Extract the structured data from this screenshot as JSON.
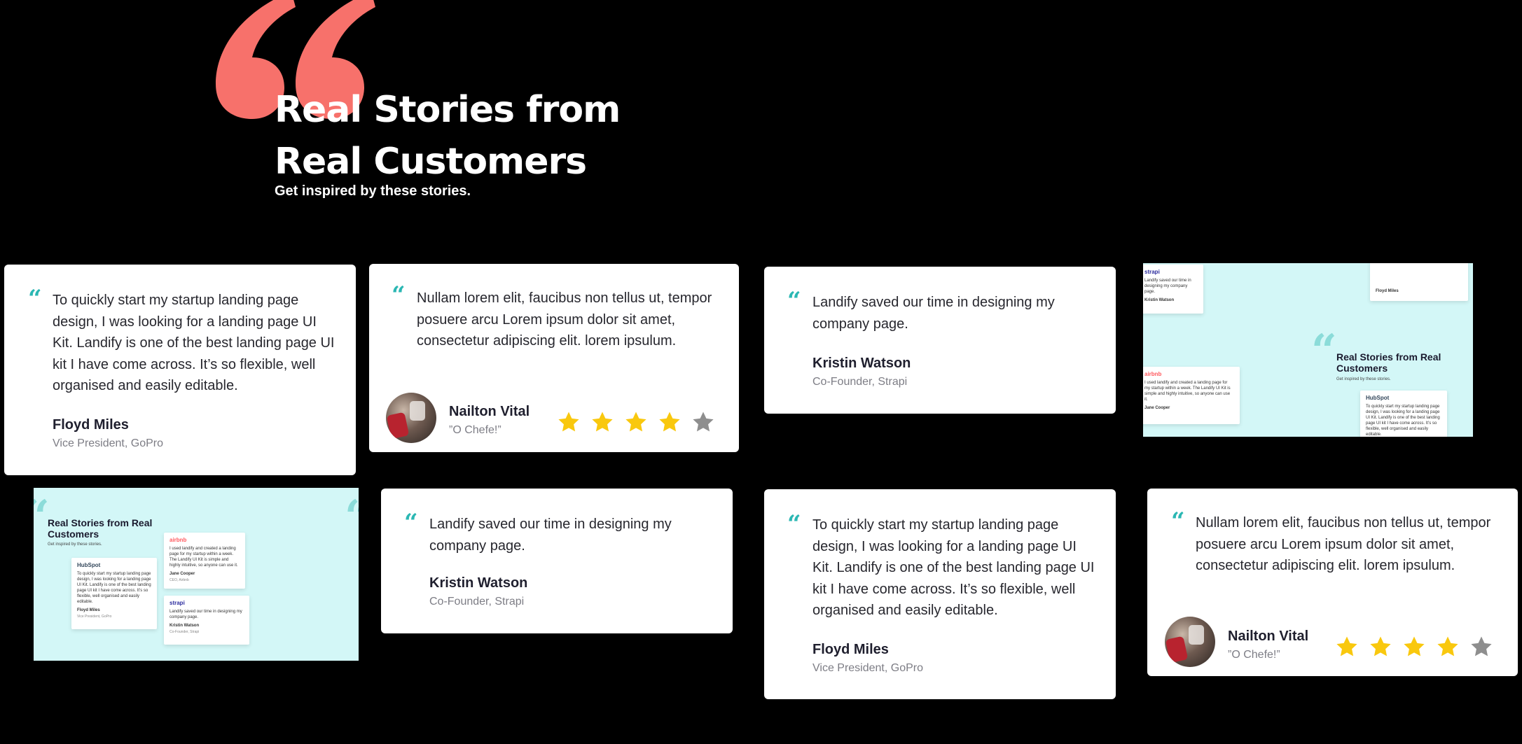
{
  "hero": {
    "title": "Real Stories from Real Customers",
    "subtitle": "Get inspired by these stories.",
    "quote_color": "#f7716b"
  },
  "colors": {
    "accent": "#2bb7b3",
    "star_filled": "#f9c80e",
    "star_empty": "#8e8e8e",
    "thumb_bg": "#d3f7f7"
  },
  "cards": [
    {
      "quote": "To quickly start my startup landing page design, I was looking for a landing page UI Kit. Landify is one of the best landing page UI kit I have come across. It’s so flexible, well organised and easily editable.",
      "name": "Floyd Miles",
      "role": "Vice President, GoPro"
    },
    {
      "quote": "Nullam lorem elit, faucibus non tellus ut, tempor posuere arcu Lorem ipsum dolor sit amet, consectetur adipiscing elit.  lorem ipsulum.",
      "name": "Nailton Vital",
      "role": "”O Chefe!”",
      "rating": 4,
      "max_rating": 5
    },
    {
      "quote": "Landify saved our time in designing my company page.",
      "name": "Kristin Watson",
      "role": "Co-Founder, Strapi"
    },
    {
      "quote": "Landify saved our time in designing my company page.",
      "name": "Kristin Watson",
      "role": "Co-Founder, Strapi"
    },
    {
      "quote": "To quickly start my startup landing page design, I was looking for a landing page UI Kit. Landify is one of the best landing page UI kit I have come across. It’s so flexible, well organised and easily editable.",
      "name": "Floyd Miles",
      "role": "Vice President, GoPro"
    },
    {
      "quote": "Nullam lorem elit, faucibus non tellus ut, tempor posuere arcu Lorem ipsum dolor sit amet, consectetur adipiscing elit.  lorem ipsulum.",
      "name": "Nailton Vital",
      "role": "”O Chefe!”",
      "rating": 4,
      "max_rating": 5
    }
  ],
  "thumbnails": {
    "title": "Real Stories from Real Customers",
    "subtitle": "Get inspired by these stories.",
    "logos": {
      "strapi": "strapi",
      "airbnb": "airbnb",
      "hubspot": "HubSpot"
    },
    "mini_quotes": {
      "strapi": "Landify saved our time in designing my company page.",
      "airbnb": "I used landify and created a landing page for my startup within a week. The Landify UI Kit is simple and highly intuitive, so anyone can use it.",
      "hubspot": "To quickly start my startup landing page design, I was looking for a landing page UI Kit. Landify is one of the best landing page UI kit I have come across. It’s so flexible, well organised and easily editable."
    },
    "mini_names": {
      "strapi": "Kristin Watson",
      "airbnb": "Jane Cooper",
      "hubspot": "Floyd Miles"
    },
    "mini_roles": {
      "strapi": "Co-Founder, Strapi",
      "airbnb": "CEO, Airbnb",
      "hubspot": "Vice President, GoPro"
    }
  }
}
